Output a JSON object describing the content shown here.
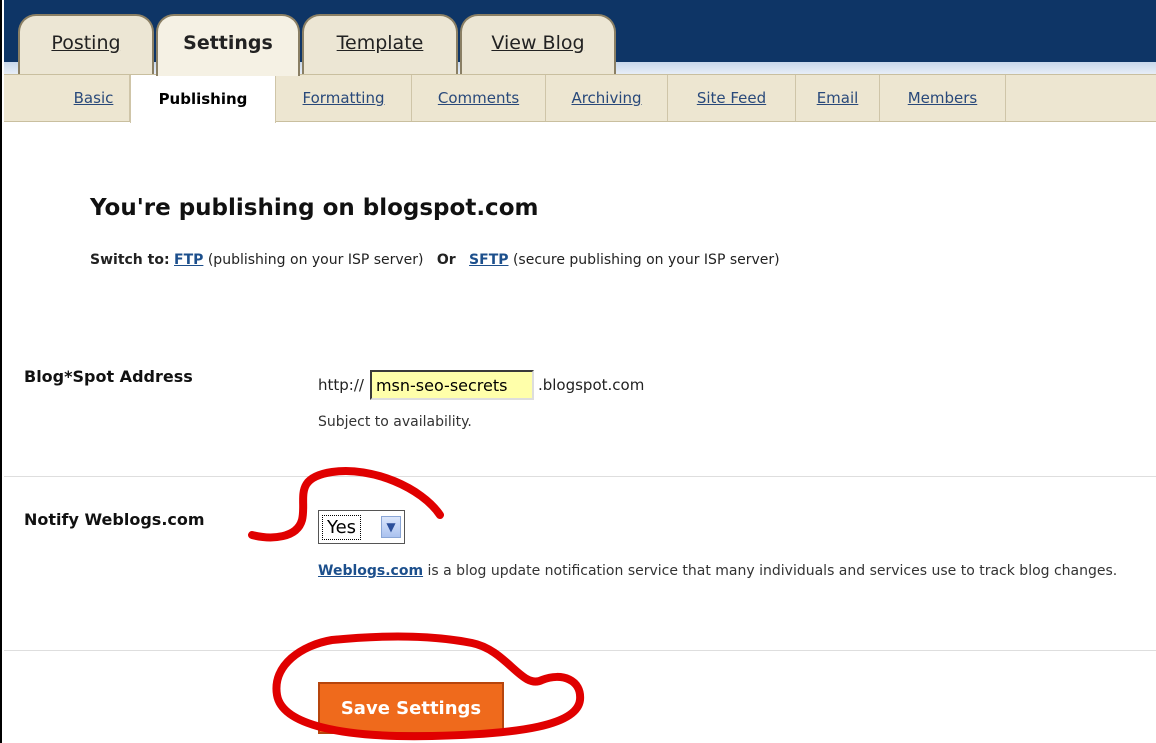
{
  "main_tabs": [
    {
      "label": "Posting",
      "active": false
    },
    {
      "label": "Settings",
      "active": true
    },
    {
      "label": "Template",
      "active": false
    },
    {
      "label": "View Blog",
      "active": false
    }
  ],
  "sub_tabs": [
    {
      "label": "Basic",
      "active": false
    },
    {
      "label": "Publishing",
      "active": true
    },
    {
      "label": "Formatting",
      "active": false
    },
    {
      "label": "Comments",
      "active": false
    },
    {
      "label": "Archiving",
      "active": false
    },
    {
      "label": "Site Feed",
      "active": false
    },
    {
      "label": "Email",
      "active": false
    },
    {
      "label": "Members",
      "active": false
    }
  ],
  "publishing": {
    "heading": "You're publishing on blogspot.com",
    "switch_to_label": "Switch to:",
    "ftp_link": "FTP",
    "ftp_desc": "(publishing on your ISP server)",
    "or_label": "Or",
    "sftp_link": "SFTP",
    "sftp_desc": "(secure publishing on your ISP server)"
  },
  "address": {
    "label": "Blog*Spot Address",
    "prefix": "http://",
    "value": "msn-seo-secrets",
    "suffix": ".blogspot.com",
    "note": "Subject to availability."
  },
  "notify": {
    "label": "Notify Weblogs.com",
    "selected": "Yes",
    "link": "Weblogs.com",
    "description": "is a blog update notification service that many individuals and services use to track blog changes."
  },
  "save_label": "Save Settings",
  "colors": {
    "header_bg": "#0e3566",
    "tab_bg": "#ece6d4",
    "link": "#1c4f8c",
    "save_button": "#ef6a1c",
    "input_bg": "#ffffaa",
    "annotation": "#e00000"
  }
}
